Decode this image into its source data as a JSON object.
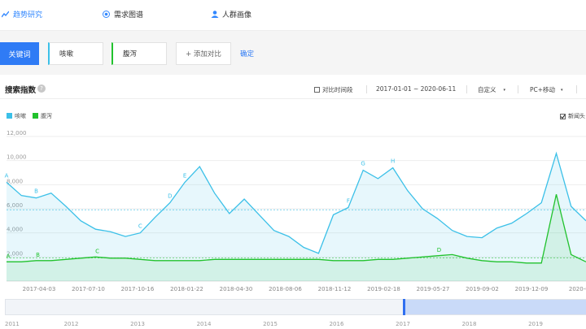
{
  "tabs": [
    {
      "label": "趋势研究",
      "icon": "trend-icon",
      "active": true
    },
    {
      "label": "需求图谱",
      "icon": "radar-icon",
      "active": false
    },
    {
      "label": "人群画像",
      "icon": "person-icon",
      "active": false
    }
  ],
  "controls": {
    "keyword_button": "关键词",
    "keyword1": "咳嗽",
    "keyword2": "腹泻",
    "add_compare": "+ 添加对比",
    "confirm": "确定"
  },
  "header": {
    "title": "搜索指数",
    "help": "?",
    "compare_period": "对比时间段",
    "date_range": "2017-01-01 ~ 2020-06-11",
    "custom": "自定义",
    "device": "PC+移动",
    "news": "新闻头"
  },
  "colors": {
    "series1": "#3bc0e8",
    "series2": "#21c22d",
    "accent": "#2f7bf5"
  },
  "chart_data": {
    "type": "area",
    "x": [
      "2017-01",
      "2017-02",
      "2017-03",
      "2017-04",
      "2017-05",
      "2017-06",
      "2017-07",
      "2017-08",
      "2017-09",
      "2017-10",
      "2017-11",
      "2017-12",
      "2018-01",
      "2018-02",
      "2018-03",
      "2018-04",
      "2018-05",
      "2018-06",
      "2018-07",
      "2018-08",
      "2018-09",
      "2018-10",
      "2018-11",
      "2018-12",
      "2019-01",
      "2019-02",
      "2019-03",
      "2019-04",
      "2019-05",
      "2019-06",
      "2019-07",
      "2019-08",
      "2019-09",
      "2019-10",
      "2019-11",
      "2019-12",
      "2020-01",
      "2020-02",
      "2020-03",
      "2020-04"
    ],
    "x_ticks": [
      "2017-04-03",
      "2017-07-10",
      "2017-10-16",
      "2018-01-22",
      "2018-04-30",
      "2018-08-06",
      "2018-11-12",
      "2019-02-18",
      "2019-05-27",
      "2019-09-02",
      "2019-12-09",
      "2020-03"
    ],
    "y_ticks": [
      "12,000",
      "10,000",
      "8,000",
      "6,000",
      "4,000",
      "2,000"
    ],
    "ylim": [
      0,
      12000
    ],
    "series": [
      {
        "name": "咳嗽",
        "values": [
          8200,
          7100,
          6900,
          7300,
          6200,
          5000,
          4300,
          4100,
          3700,
          4000,
          5300,
          6500,
          8200,
          9500,
          7300,
          5600,
          6800,
          5500,
          4200,
          3700,
          2800,
          2300,
          5500,
          6100,
          9200,
          8500,
          9400,
          7500,
          6000,
          5200,
          4200,
          3700,
          3600,
          4400,
          4800,
          5600,
          6500,
          10600,
          6200,
          5000
        ]
      },
      {
        "name": "腹泻",
        "values": [
          1600,
          1600,
          1700,
          1700,
          1800,
          1900,
          2000,
          1900,
          1900,
          1800,
          1700,
          1700,
          1700,
          1700,
          1800,
          1800,
          1800,
          1800,
          1800,
          1800,
          1800,
          1800,
          1700,
          1700,
          1700,
          1800,
          1800,
          1900,
          2000,
          2100,
          2200,
          1900,
          1700,
          1600,
          1600,
          1500,
          1500,
          7200,
          2200,
          1600
        ]
      }
    ],
    "annotations": [
      "A",
      "B",
      "C",
      "D",
      "E",
      "F",
      "G",
      "H"
    ],
    "slider_years": [
      "2011",
      "2012",
      "2013",
      "2014",
      "2015",
      "2016",
      "2017",
      "2018",
      "2019"
    ]
  }
}
